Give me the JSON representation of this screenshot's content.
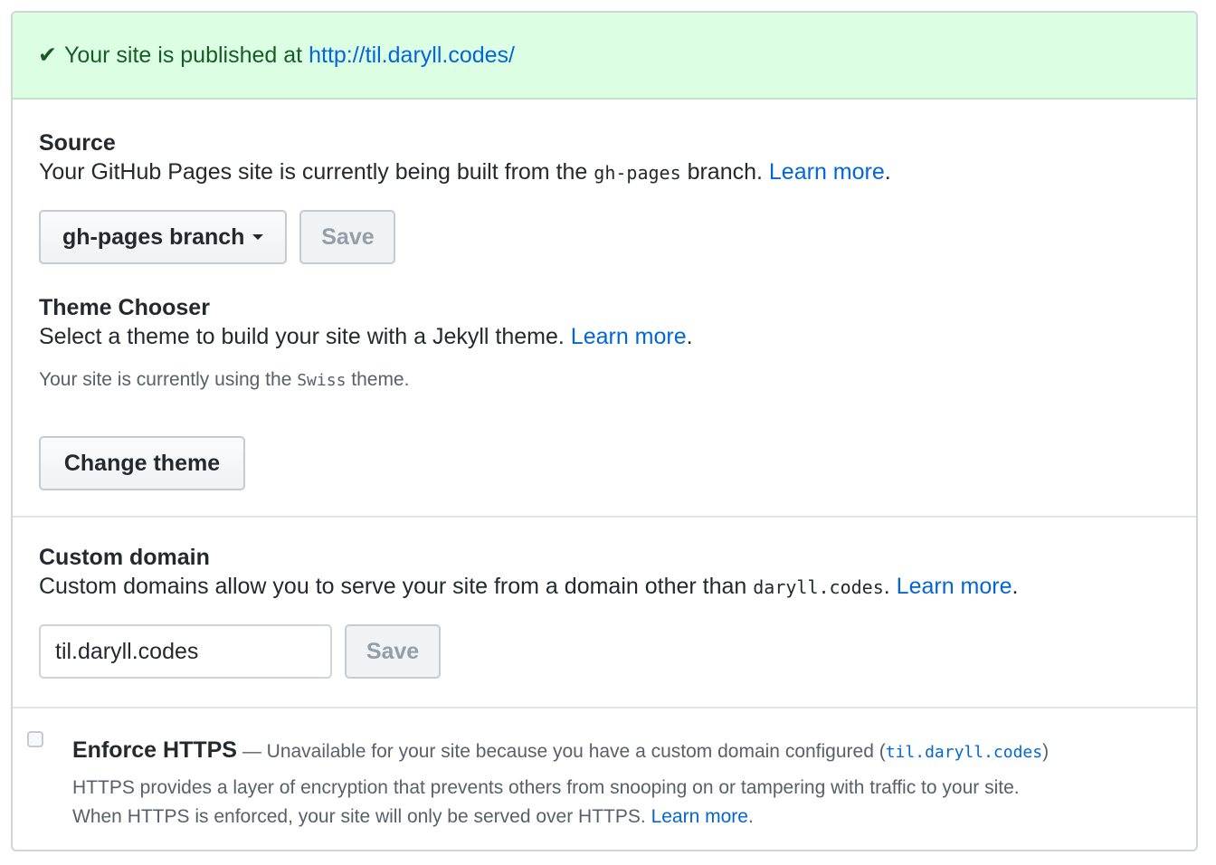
{
  "banner": {
    "icon": "check-icon",
    "check_glyph": "✔",
    "text": "Your site is published at",
    "url": "http://til.daryll.codes/"
  },
  "source": {
    "title": "Source",
    "desc_before": "Your GitHub Pages site is currently being built from the",
    "branch_code": "gh-pages",
    "desc_after": "branch.",
    "learn_more": "Learn more",
    "branch_select_label": "gh-pages branch",
    "save_label": "Save"
  },
  "theme": {
    "title": "Theme Chooser",
    "desc": "Select a theme to build your site with a Jekyll theme.",
    "learn_more": "Learn more",
    "current_before": "Your site is currently using the",
    "current_theme": "Swiss",
    "current_after": "theme.",
    "change_label": "Change theme"
  },
  "custom_domain": {
    "title": "Custom domain",
    "desc": "Custom domains allow you to serve your site from a domain other than",
    "domain_code": "daryll.codes",
    "learn_more": "Learn more",
    "input_value": "til.daryll.codes",
    "save_label": "Save"
  },
  "https": {
    "title": "Enforce HTTPS",
    "dash_note": "— Unavailable for your site because you have a custom domain configured (",
    "domain_code": "til.daryll.codes",
    "note_close": ")",
    "line1": "HTTPS provides a layer of encryption that prevents others from snooping on or tampering with traffic to your site.",
    "line2": "When HTTPS is enforced, your site will only be served over HTTPS.",
    "learn_more": "Learn more",
    "checked": false
  },
  "colors": {
    "accent": "#0366d6",
    "success_bg": "#dcffe4",
    "success_text": "#165c26"
  }
}
